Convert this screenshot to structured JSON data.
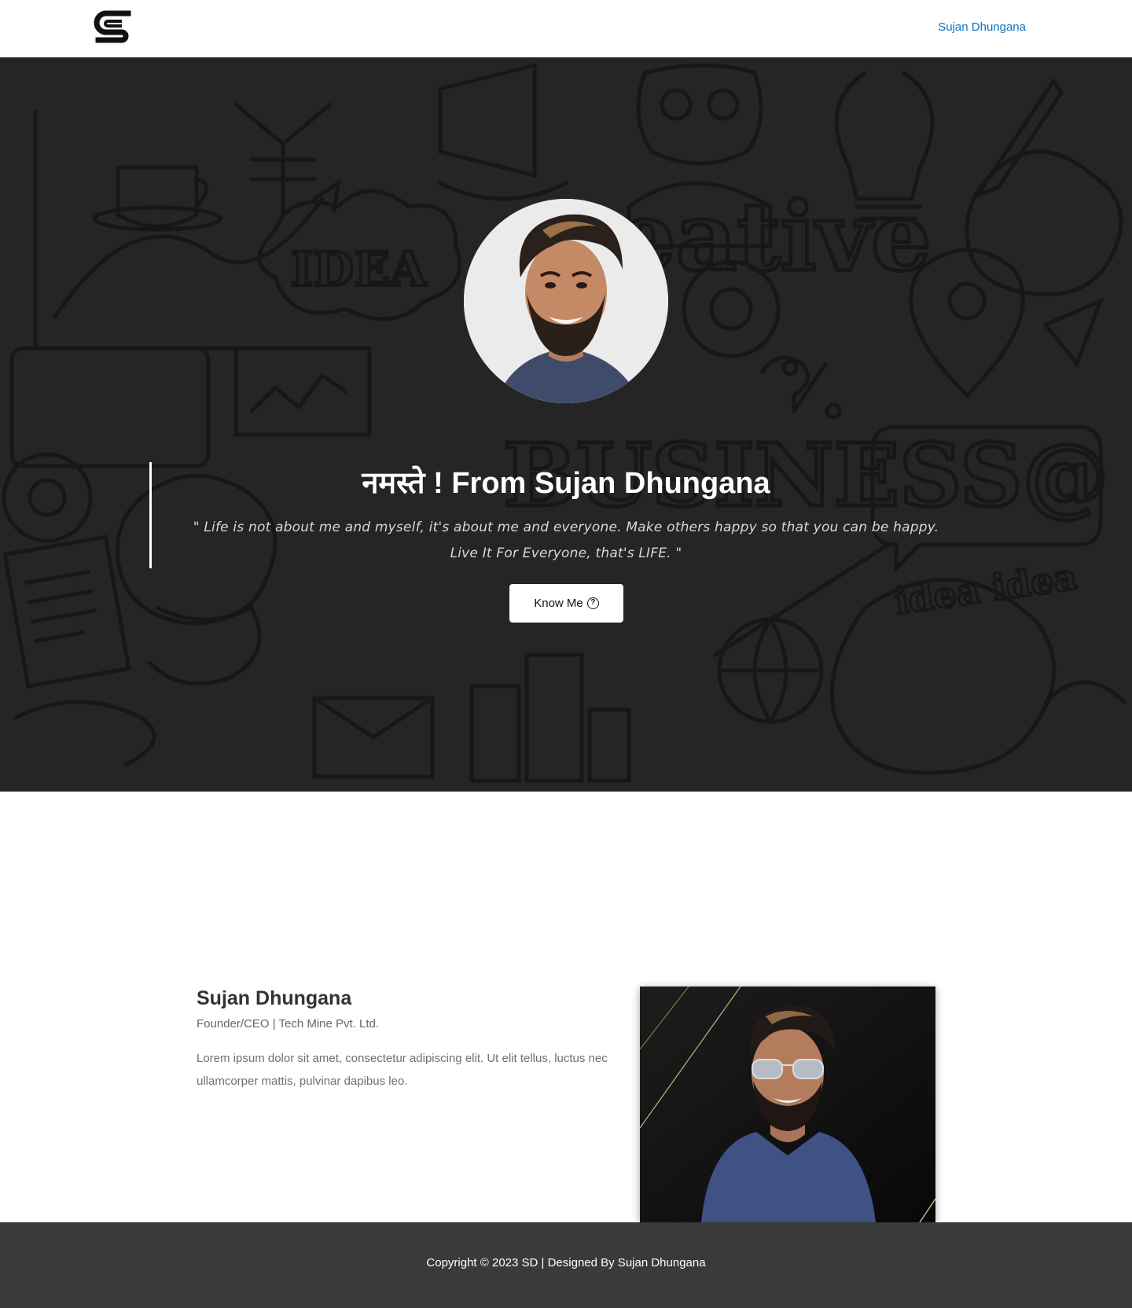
{
  "header": {
    "logo_icon": "sd-monogram-logo",
    "nav_link": "Sujan Dhungana"
  },
  "hero": {
    "title": "नमस्ते ! From Sujan Dhungana",
    "quote": "\" Life is not about me and myself, it's about me and everyone. Make others happy so that you can be happy. Live It For Everyone, that's LIFE. \"",
    "button_label": "Know Me",
    "button_icon": "question-circle-icon",
    "background_words": [
      "Creative",
      "IDEA",
      "BUSINESS",
      "idea"
    ]
  },
  "about": {
    "name": "Sujan Dhungana",
    "role": "Founder/CEO | Tech Mine Pvt. Ltd.",
    "text": "Lorem ipsum dolor sit amet, consectetur adipiscing elit. Ut elit tellus, luctus nec ullamcorper mattis, pulvinar dapibus leo."
  },
  "footer": {
    "copyright": "Copyright © 2023 SD | Designed By Sujan Dhungana"
  },
  "colors": {
    "accent_link": "#0b74c4",
    "hero_bg": "#2a2a2a",
    "footer_bg": "#3a3a3b"
  }
}
